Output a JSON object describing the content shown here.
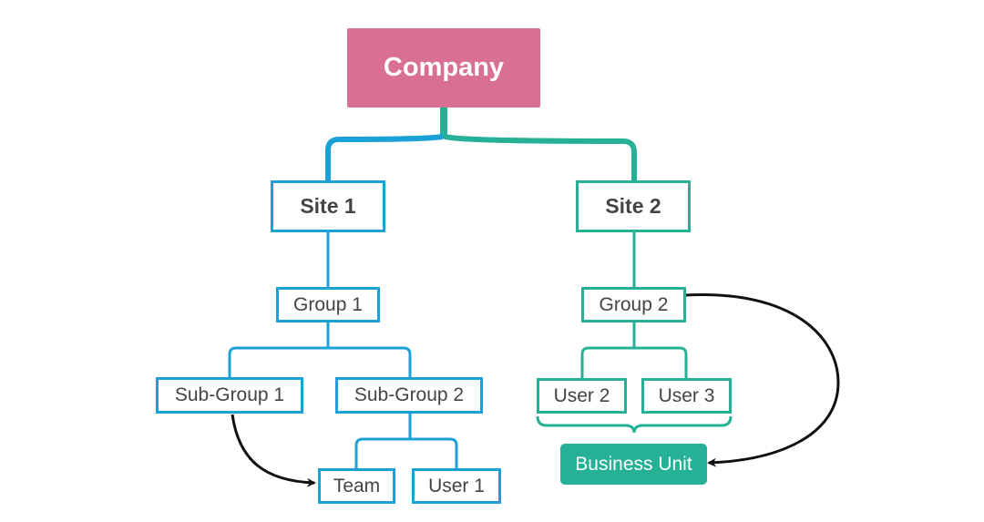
{
  "diagram": {
    "type": "organization-chart",
    "colors": {
      "root": "#d96f93",
      "branch_site1": "#1ca0d8",
      "branch_site2": "#26b095",
      "text": "#444444",
      "arrow": "#111111"
    },
    "nodes": {
      "company": "Company",
      "site1": "Site 1",
      "site2": "Site 2",
      "group1": "Group 1",
      "group2": "Group 2",
      "subgroup1": "Sub-Group 1",
      "subgroup2": "Sub-Group 2",
      "team": "Team",
      "user1": "User 1",
      "user2": "User 2",
      "user3": "User 3",
      "business_unit": "Business Unit"
    },
    "edges": [
      {
        "from": "Company",
        "to": "Site 1"
      },
      {
        "from": "Company",
        "to": "Site 2"
      },
      {
        "from": "Site 1",
        "to": "Group 1"
      },
      {
        "from": "Group 1",
        "to": "Sub-Group 1"
      },
      {
        "from": "Group 1",
        "to": "Sub-Group 2"
      },
      {
        "from": "Sub-Group 2",
        "to": "Team"
      },
      {
        "from": "Sub-Group 2",
        "to": "User 1"
      },
      {
        "from": "Site 2",
        "to": "Group 2"
      },
      {
        "from": "Group 2",
        "to": "User 2"
      },
      {
        "from": "Group 2",
        "to": "User 3"
      }
    ],
    "arrows": [
      {
        "from": "Sub-Group 1",
        "to": "Team"
      },
      {
        "from": "Group 2",
        "to": "Business Unit"
      }
    ],
    "brace": {
      "groups": [
        "User 2",
        "User 3"
      ],
      "to": "Business Unit"
    }
  }
}
